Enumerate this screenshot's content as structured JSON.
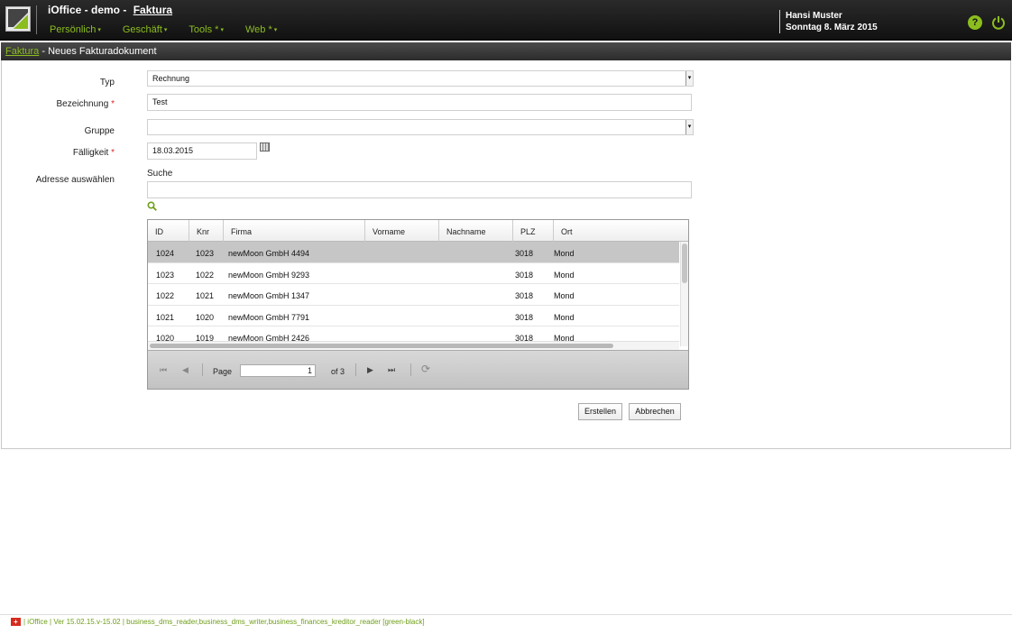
{
  "header": {
    "app_title": "iOffice - demo -",
    "module_title": "Faktura",
    "nav": [
      {
        "label": "Persönlich",
        "caret": "▾"
      },
      {
        "label": "Geschäft",
        "caret": "▾"
      },
      {
        "label": "Tools *",
        "caret": "▾"
      },
      {
        "label": "Web *",
        "caret": "▾"
      }
    ],
    "user_name": "Hansi Muster",
    "date": "Sonntag 8. März 2015",
    "help_icon": "?",
    "power_icon": "⏻"
  },
  "breadcrumb": {
    "link": "Faktura",
    "separator": " - ",
    "current": "Neues Fakturadokument"
  },
  "form": {
    "typ_label": "Typ",
    "typ_value": "Rechnung",
    "bezeichnung_label": "Bezeichnung",
    "bezeichnung_value": "Test",
    "gruppe_label": "Gruppe",
    "gruppe_value": "",
    "faelligkeit_label": "Fälligkeit",
    "faelligkeit_value": "18.03.2015",
    "adresse_label": "Adresse auswählen",
    "suche_label": "Suche",
    "suche_value": "",
    "required_mark": "*",
    "select_arrow": "▾"
  },
  "grid": {
    "columns": [
      "ID",
      "Knr",
      "Firma",
      "Vorname",
      "Nachname",
      "PLZ",
      "Ort"
    ],
    "rows": [
      {
        "id": "1024",
        "knr": "1023",
        "firma": "newMoon GmbH 4494",
        "vorname": "",
        "nachname": "",
        "plz": "3018",
        "ort": "Mond"
      },
      {
        "id": "1023",
        "knr": "1022",
        "firma": "newMoon GmbH 9293",
        "vorname": "",
        "nachname": "",
        "plz": "3018",
        "ort": "Mond"
      },
      {
        "id": "1022",
        "knr": "1021",
        "firma": "newMoon GmbH 1347",
        "vorname": "",
        "nachname": "",
        "plz": "3018",
        "ort": "Mond"
      },
      {
        "id": "1021",
        "knr": "1020",
        "firma": "newMoon GmbH 7791",
        "vorname": "",
        "nachname": "",
        "plz": "3018",
        "ort": "Mond"
      },
      {
        "id": "1020",
        "knr": "1019",
        "firma": "newMoon GmbH 2426",
        "vorname": "",
        "nachname": "",
        "plz": "3018",
        "ort": "Mond"
      }
    ],
    "pager": {
      "first": "⏮",
      "prev": "◀",
      "page_label": "Page",
      "page_value": "1",
      "of_label": "of 3",
      "next": "▶",
      "last": "⏭",
      "refresh": "⟳"
    }
  },
  "actions": {
    "create": "Erstellen",
    "cancel": "Abbrechen"
  },
  "footer": {
    "flag": "+",
    "text": "| iOffice | Ver 15.02.15.v-15.02 | business_dms_reader,business_dms_writer,business_finances_kreditor_reader [green-black]"
  },
  "colors": {
    "accent": "#8cbd1f",
    "header_bg": "#1a1a1a",
    "selected_row": "#c6c6c6",
    "required": "#d9292a"
  },
  "icons": {
    "logo": "ioffice-logo",
    "calendar": "calendar-icon",
    "search": "search-icon"
  }
}
